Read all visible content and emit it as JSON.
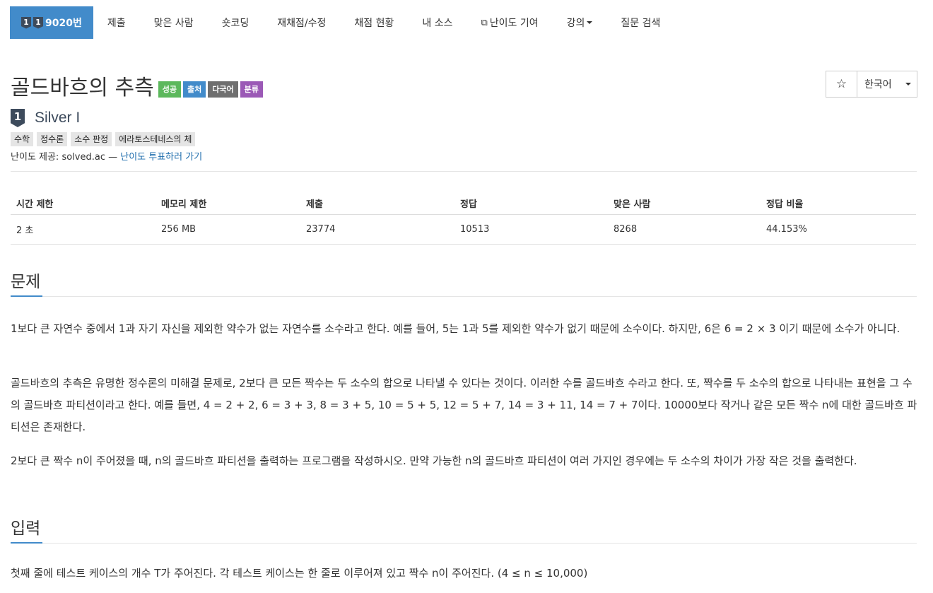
{
  "nav": {
    "problem_id": "9020번",
    "tier_digit": "1",
    "items": [
      {
        "label": "제출"
      },
      {
        "label": "맞은 사람"
      },
      {
        "label": "숏코딩"
      },
      {
        "label": "재채점/수정"
      },
      {
        "label": "채점 현황"
      },
      {
        "label": "내 소스"
      },
      {
        "label": "난이도 기여",
        "icon": "external-link-icon"
      },
      {
        "label": "강의",
        "dropdown": true
      },
      {
        "label": "질문 검색"
      }
    ]
  },
  "problem": {
    "title": "골드바흐의 추측",
    "labels": [
      {
        "text": "성공",
        "color": "#5cb85c"
      },
      {
        "text": "출처",
        "color": "#428bca"
      },
      {
        "text": "다국어",
        "color": "#6f6f6f"
      },
      {
        "text": "분류",
        "color": "#9b59b6"
      }
    ],
    "tier_digit": "1",
    "tier_name": "Silver I",
    "tags": [
      "수학",
      "정수론",
      "소수 판정",
      "에라토스테네스의 체"
    ],
    "credit_prefix": "난이도 제공: solved.ac —",
    "credit_link": "난이도 투표하러 가기"
  },
  "controls": {
    "star_icon": "☆",
    "language": "한국어"
  },
  "stats": {
    "headers": [
      "시간 제한",
      "메모리 제한",
      "제출",
      "정답",
      "맞은 사람",
      "정답 비율"
    ],
    "values": [
      "2 초",
      "256 MB",
      "23774",
      "10513",
      "8268",
      "44.153%"
    ]
  },
  "sections": {
    "problem_heading": "문제",
    "problem_paragraphs": [
      "1보다 큰 자연수 중에서  1과 자기 자신을 제외한 약수가 없는 자연수를 소수라고 한다. 예를 들어, 5는 1과 5를 제외한 약수가 없기 때문에 소수이다. 하지만, 6은 6 = 2 × 3 이기 때문에 소수가 아니다.",
      "골드바흐의 추측은 유명한 정수론의 미해결 문제로, 2보다 큰 모든 짝수는 두 소수의 합으로 나타낼 수 있다는 것이다. 이러한 수를 골드바흐 수라고 한다. 또, 짝수를 두 소수의 합으로 나타내는 표현을 그 수의 골드바흐 파티션이라고 한다. 예를 들면, 4 = 2 + 2, 6 = 3 + 3, 8 = 3 + 5, 10 = 5 + 5, 12 = 5 + 7, 14 = 3 + 11, 14 = 7 + 7이다. 10000보다 작거나 같은 모든 짝수 n에 대한 골드바흐 파티션은 존재한다.",
      "2보다 큰 짝수 n이 주어졌을 때, n의 골드바흐 파티션을 출력하는 프로그램을 작성하시오. 만약 가능한 n의 골드바흐 파티션이 여러 가지인 경우에는 두 소수의 차이가 가장 작은 것을 출력한다."
    ],
    "input_heading": "입력",
    "input_paragraph": "첫째 줄에 테스트 케이스의 개수 T가 주어진다. 각 테스트 케이스는 한 줄로 이루어져 있고 짝수 n이 주어진다. (4 ≤ n ≤ 10,000)"
  }
}
